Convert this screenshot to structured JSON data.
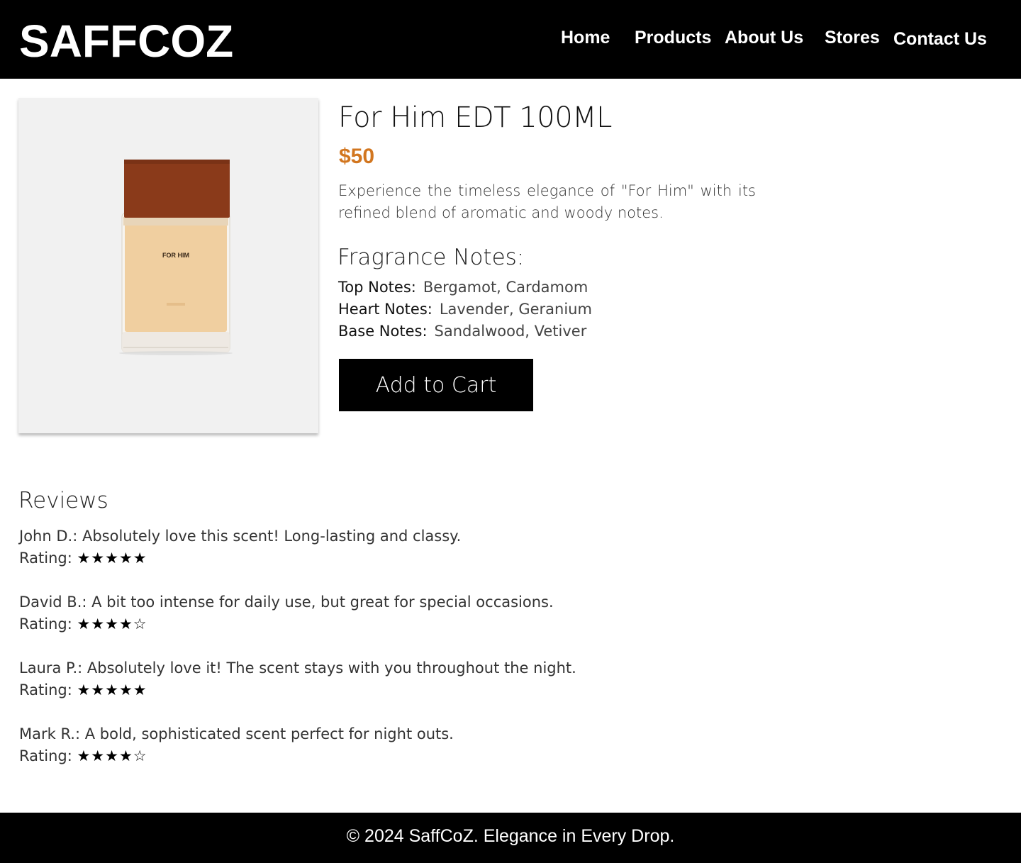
{
  "header": {
    "brand": "SAFFCOZ",
    "nav": [
      "Home",
      "Products",
      "About Us",
      "Stores",
      "Contact Us"
    ]
  },
  "product": {
    "title": "For Him EDT 100ML",
    "price": "$50",
    "description": "Experience the timeless elegance of \"For Him\" with its refined blend of aromatic and woody notes.",
    "image_label": "FOR HIM",
    "notes_heading": "Fragrance Notes:",
    "notes": [
      {
        "label": "Top Notes:",
        "value": "Bergamot, Cardamom"
      },
      {
        "label": "Heart Notes:",
        "value": "Lavender, Geranium"
      },
      {
        "label": "Base Notes:",
        "value": "Sandalwood, Vetiver"
      }
    ],
    "cta": "Add to Cart"
  },
  "reviews": {
    "heading": "Reviews",
    "rating_label": "Rating:",
    "items": [
      {
        "author": "John D.",
        "text": "Absolutely love this scent! Long-lasting and classy.",
        "rating": 5,
        "stars": "★★★★★"
      },
      {
        "author": "David B.",
        "text": "A bit too intense for daily use, but great for special occasions.",
        "rating": 4,
        "stars": "★★★★☆"
      },
      {
        "author": "Laura P.",
        "text": "Absolutely love it! The scent stays with you throughout the night.",
        "rating": 5,
        "stars": "★★★★★"
      },
      {
        "author": "Mark R.",
        "text": "A bold, sophisticated scent perfect for night outs.",
        "rating": 4,
        "stars": "★★★★☆"
      }
    ]
  },
  "footer": {
    "text": "© 2024 SaffCoZ. Elegance in Every Drop."
  },
  "colors": {
    "header_bg": "#000000",
    "price": "#d2761f",
    "button_bg": "#000000",
    "image_bg": "#f1f1f1",
    "bottle_cap": "#8a3a1a",
    "bottle_liquid": "#f0cfa0"
  }
}
